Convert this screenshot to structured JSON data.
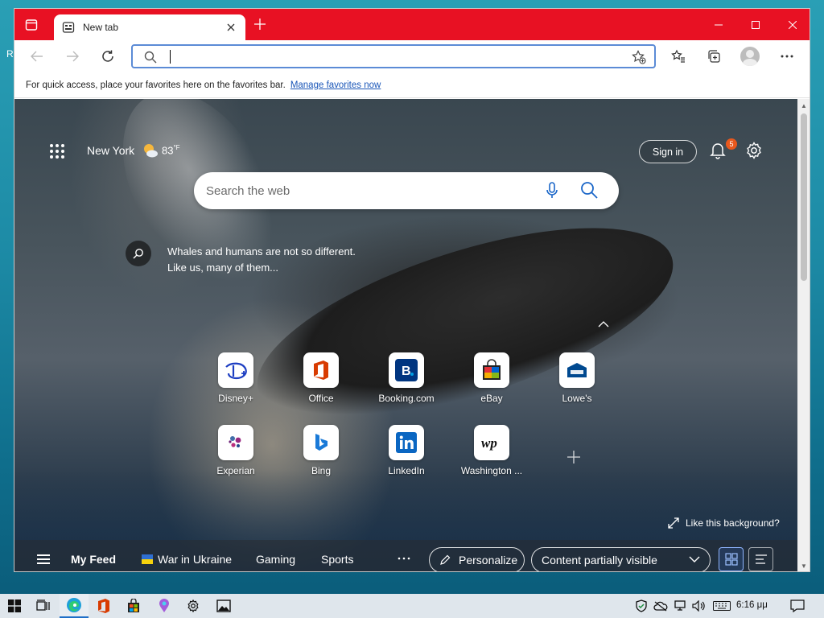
{
  "desktop": {
    "letter": "R"
  },
  "browser": {
    "tab": {
      "title": "New tab"
    },
    "address": {
      "value": "",
      "placeholder": ""
    },
    "favbar": {
      "text": "For quick access, place your favorites here on the favorites bar.",
      "link": "Manage favorites now"
    }
  },
  "newtab": {
    "weather": {
      "city": "New York",
      "temp": "83",
      "unit": "°F"
    },
    "sign_in": "Sign in",
    "notifications_count": "5",
    "search_placeholder": "Search the web",
    "image_info": {
      "line1": "Whales and humans are not so different.",
      "line2": "Like us, many of them..."
    },
    "tiles": [
      {
        "label": "Disney+",
        "icon": "disney-icon"
      },
      {
        "label": "Office",
        "icon": "office-icon"
      },
      {
        "label": "Booking.com",
        "icon": "booking-icon"
      },
      {
        "label": "eBay",
        "icon": "ebay-icon"
      },
      {
        "label": "Lowe's",
        "icon": "lowes-icon"
      },
      {
        "label": "Experian",
        "icon": "experian-icon"
      },
      {
        "label": "Bing",
        "icon": "bing-icon"
      },
      {
        "label": "LinkedIn",
        "icon": "linkedin-icon"
      },
      {
        "label": "Washington ...",
        "icon": "washington-post-icon"
      }
    ],
    "like_background": "Like this background?",
    "feed": {
      "my_feed": "My Feed",
      "items": [
        "War in Ukraine",
        "Gaming",
        "Sports"
      ],
      "personalize": "Personalize",
      "content_visibility": "Content partially visible"
    }
  },
  "taskbar": {
    "time": "6:16 μμ"
  },
  "colors": {
    "titlebar": "#e81123",
    "accent": "#1a66c8",
    "badge": "#e8581d"
  }
}
